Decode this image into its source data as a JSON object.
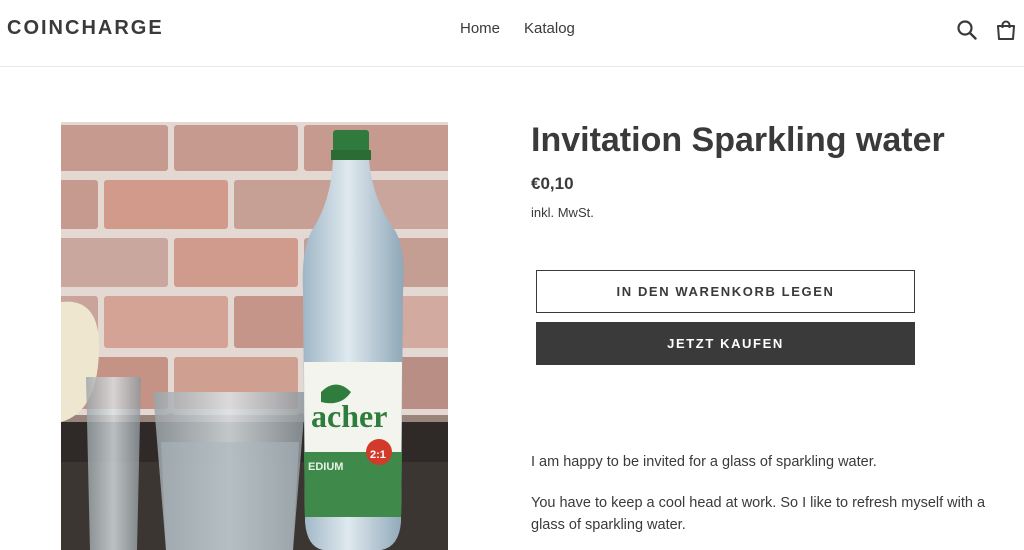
{
  "header": {
    "logo": "COINCHARGE",
    "nav": [
      "Home",
      "Katalog"
    ],
    "icons": [
      "search-icon",
      "cart-icon"
    ]
  },
  "product": {
    "image_alt": "Invitation Sparkling water",
    "title": "Invitation Sparkling water",
    "price": "€0,10",
    "tax_note": "inkl. MwSt.",
    "add_to_cart_label": "IN DEN WARENKORB LEGEN",
    "buy_now_label": "JETZT KAUFEN",
    "description": [
      "I am happy to be invited for a glass of sparkling water.",
      "You have to keep a cool head at work. So I like to refresh myself with a glass of sparkling water."
    ]
  },
  "colors": {
    "text": "#3a3a3a",
    "button_dark": "#3a3a3a",
    "background": "#ffffff"
  }
}
